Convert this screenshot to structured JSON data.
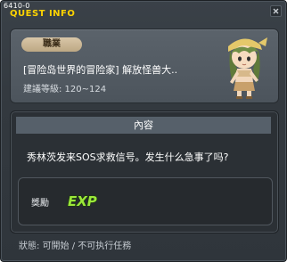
{
  "window": {
    "id_label": "6410-0",
    "title": "QUEST INFO"
  },
  "quest": {
    "job_badge": "職業",
    "title": "[冒险岛世界的冒险家] 解放怪兽大..",
    "level_requirement": "建議等級: 120~124",
    "npc_icon": "npc-portrait-icon"
  },
  "content": {
    "header": "內容",
    "description": "秀林茨发来SOS求救信号。发生什么急事了吗?",
    "reward_label": "獎勵",
    "reward_icon": "exp-icon",
    "reward_text": "EXP"
  },
  "status": {
    "text": "狀態: 可開始 / 不可执行任務"
  },
  "colors": {
    "title": "#ffd400",
    "exp_fill": "#9be83a",
    "badge": "#d9c7a8"
  }
}
